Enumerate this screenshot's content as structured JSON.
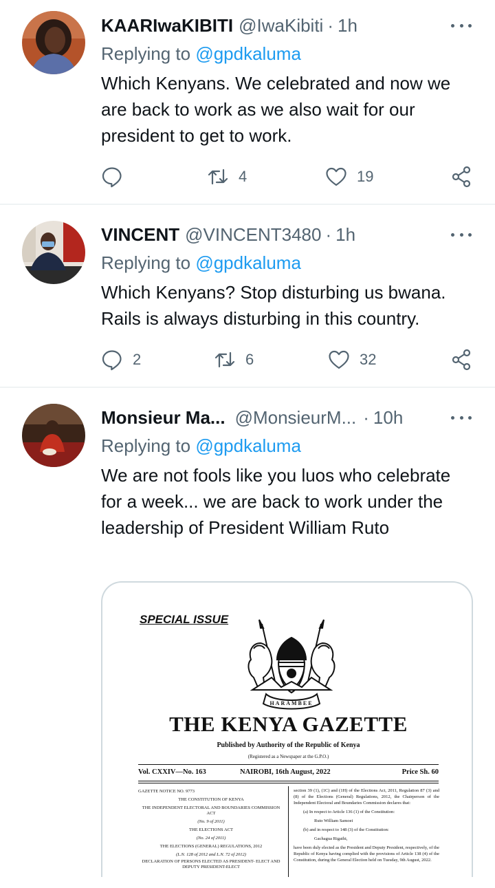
{
  "tweets": [
    {
      "name": "KAARIwaKIBITI",
      "handle": "@IwaKibiti",
      "dot": "·",
      "time": "1h",
      "replying_label": "Replying to",
      "replying_to": "@gpdkaluma",
      "text": "Which Kenyans. We celebrated and now we are back to work as we also wait for our president to get to work.",
      "replies": "",
      "retweets": "4",
      "likes": "19"
    },
    {
      "name": "VINCENT",
      "handle": "@VINCENT3480",
      "dot": "·",
      "time": "1h",
      "replying_label": "Replying to",
      "replying_to": "@gpdkaluma",
      "text": "Which Kenyans? Stop disturbing us bwana. Rails is always disturbing in this country.",
      "replies": "2",
      "retweets": "6",
      "likes": "32"
    },
    {
      "name": "Monsieur Ma...",
      "handle": "@MonsieurM...",
      "dot": "·",
      "time": "10h",
      "replying_label": "Replying to",
      "replying_to": "@gpdkaluma",
      "text": "We are not fools like you luos who celebrate for a week... we are back to work under the leadership of President William Ruto"
    }
  ],
  "gazette": {
    "special_issue": "SPECIAL ISSUE",
    "motto": "HARAMBEE",
    "title": "THE KENYA GAZETTE",
    "published_by": "Published by Authority of the Republic of Kenya",
    "registered": "(Registered as a Newspaper at the G.P.O.)",
    "volume": "Vol. CXXIV—No. 163",
    "place_date": "NAIROBI, 16th August, 2022",
    "price": "Price Sh. 60",
    "left_col": [
      "GAZETTE NOTICE NO. 9773",
      "THE CONSTITUTION OF KENYA",
      "THE INDEPENDENT ELECTORAL AND BOUNDARIES COMMISSION ACT",
      "(No. 9 of 2011)",
      "THE ELECTIONS ACT",
      "(No. 24 of 2011)",
      "THE ELECTIONS (GENERAL) REGULATIONS, 2012",
      "(L.N. 128 of 2012 and L.N. 72 of 2012)",
      "DECLARATION OF PERSONS ELECTED AS PRESIDENT- ELECT AND DEPUTY PRESIDENT-ELECT"
    ],
    "right_col": {
      "p1": "section 39 (1), (1C) and (1H) of the Elections Act, 2011, Regulation 87 (3) and (8) of the Elections (General) Regulations, 2012, the Chairperson of the Independent Electoral and Boundaries Commission declares that:",
      "a": "(a) In respect to Article 136 (1) of the Constitution:",
      "a_name": "Ruto William Samoei",
      "b": "(b) and in respect to 148 (3) of the Constitution:",
      "b_name": "Gachagua Rigathi,",
      "p2": "have been duly elected as the President and Deputy President, respectively, of the Republic of Kenya having complied with the provisions of Article 138 (4) of the Constitution, during the General Election held on Tuesday, 9th August, 2022."
    }
  },
  "colors": {
    "link": "#1d9bf0",
    "muted": "#536471",
    "text": "#0f1419",
    "divider": "#eff3f4"
  },
  "icons": [
    "reply-icon",
    "retweet-icon",
    "like-icon",
    "share-icon",
    "more-icon"
  ]
}
